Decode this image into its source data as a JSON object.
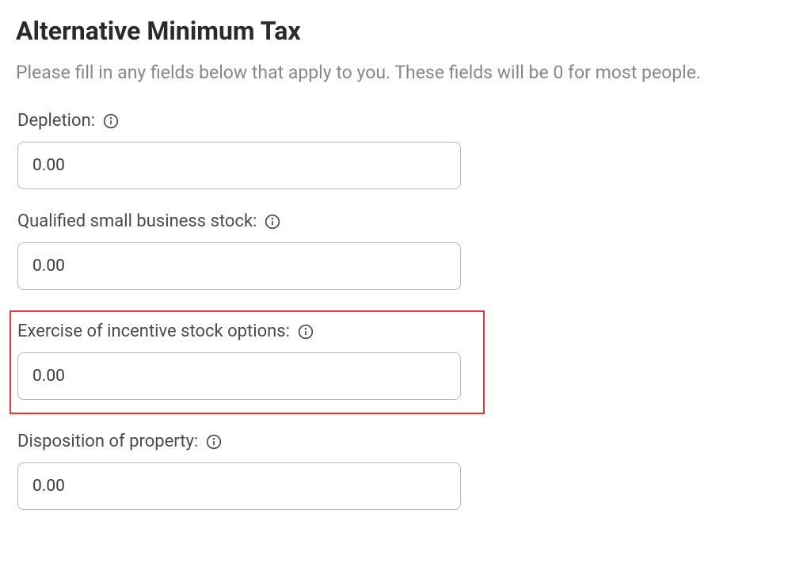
{
  "heading": "Alternative Minimum Tax",
  "description": "Please fill in any fields below that apply to you. These fields will be 0 for most people.",
  "fields": {
    "depletion": {
      "label": "Depletion:",
      "value": "0.00"
    },
    "qsbs": {
      "label": "Qualified small business stock:",
      "value": "0.00"
    },
    "iso": {
      "label": "Exercise of incentive stock options:",
      "value": "0.00"
    },
    "disposition": {
      "label": "Disposition of property:",
      "value": "0.00"
    }
  }
}
